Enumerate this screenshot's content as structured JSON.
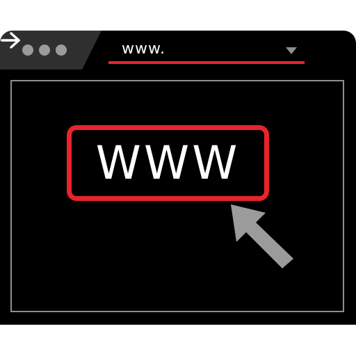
{
  "address_bar": {
    "url": "www."
  },
  "content": {
    "www_label": "WWW"
  },
  "colors": {
    "window_background": "#000000",
    "accent_red": "#e8242a",
    "chrome_gray": "#9b9b9b",
    "page_border": "#8f8f8f",
    "text_white": "#ffffff"
  },
  "icons": {
    "window_controls": "traffic-light-dots",
    "dropdown": "triangle-down-icon",
    "go": "arrow-right-icon",
    "pointer": "mouse-cursor-icon"
  }
}
